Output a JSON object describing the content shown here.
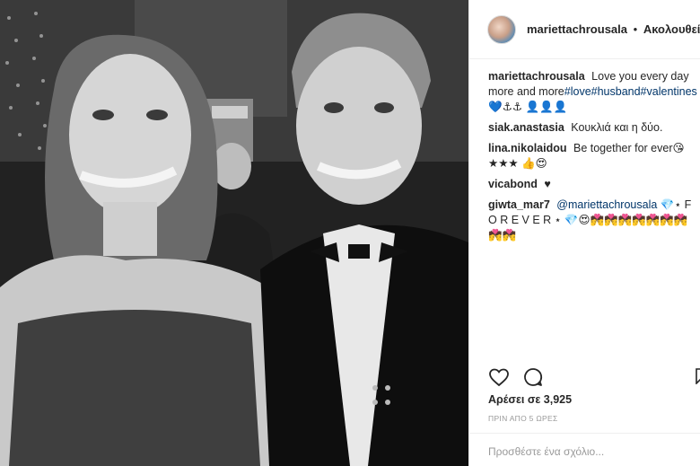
{
  "post": {
    "username": "mariettachrousala",
    "separator": "•",
    "follow_label": "Ακολουθείτε"
  },
  "comments": [
    {
      "user": "mariettachrousala",
      "text": "Love you every day more and more",
      "tags": "#love#husband#valentines",
      "emoji": "💙⚓⚓ 👤👤👤"
    },
    {
      "user": "siak.anastasia",
      "text": "Κουκλιά και η δύο.",
      "tags": "",
      "emoji": ""
    },
    {
      "user": "lina.nikolaidou",
      "text": "Be together for ever",
      "tags": "",
      "emoji": "😘★★★ 👍😍"
    },
    {
      "user": "vicabond",
      "text": "",
      "tags": "",
      "emoji": "♥"
    },
    {
      "user": "giwta_mar7",
      "text": "",
      "tags": "@mariettachrousala",
      "emoji": "💎⋆ F O R E V E R ⋆ 💎😍💏💏💏💏💏💏💏💏💏"
    }
  ],
  "actions": {
    "like_icon": "heart-icon",
    "comment_icon": "comment-icon",
    "bookmark_icon": "bookmark-icon"
  },
  "likes_text": "Αρέσει σε 3,925",
  "time_text": "ΠΡΙΝ ΑΠΟ 5 ΩΡΕΣ",
  "add_comment_placeholder": "Προσθέστε ένα σχόλιο..."
}
